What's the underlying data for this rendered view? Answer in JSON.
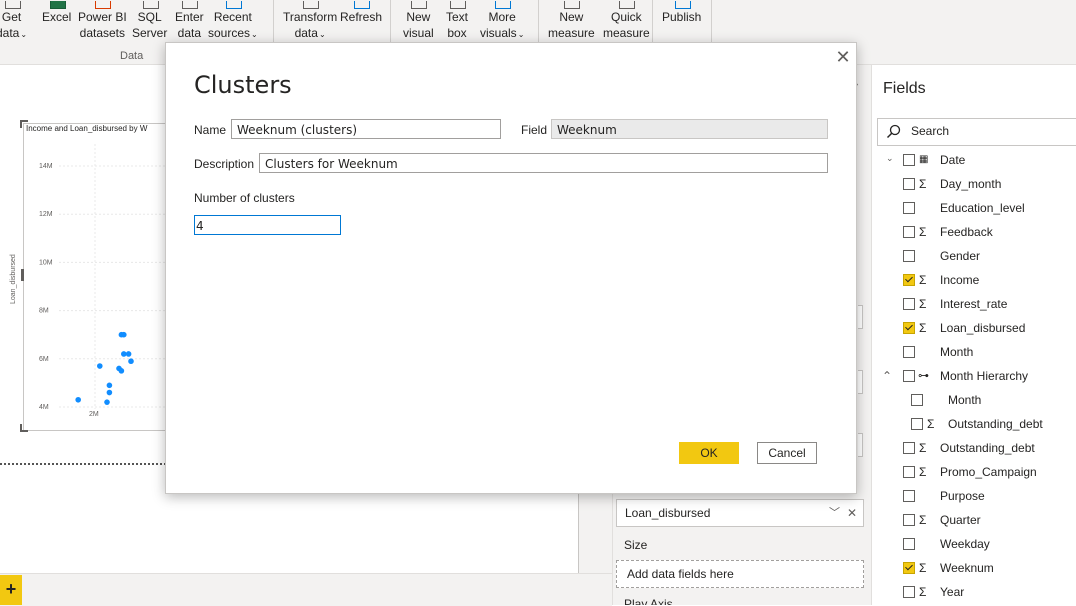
{
  "ribbon": {
    "buttons": [
      {
        "id": "get-data",
        "l1": "Get",
        "l2": "data",
        "chev": true
      },
      {
        "id": "excel",
        "l1": "Excel",
        "l2": "",
        "chev": false
      },
      {
        "id": "power-bi-datasets",
        "l1": "Power BI",
        "l2": "datasets",
        "chev": false
      },
      {
        "id": "sql-server",
        "l1": "SQL",
        "l2": "Server",
        "chev": false
      },
      {
        "id": "enter-data",
        "l1": "Enter",
        "l2": "data",
        "chev": false
      },
      {
        "id": "recent-sources",
        "l1": "Recent",
        "l2": "sources",
        "chev": true
      },
      {
        "id": "transform-data",
        "l1": "Transform",
        "l2": "data",
        "chev": true
      },
      {
        "id": "refresh",
        "l1": "Refresh",
        "l2": "",
        "chev": false
      },
      {
        "id": "new-visual",
        "l1": "New",
        "l2": "visual",
        "chev": false
      },
      {
        "id": "text-box",
        "l1": "Text",
        "l2": "box",
        "chev": false
      },
      {
        "id": "more-visuals",
        "l1": "More",
        "l2": "visuals",
        "chev": true
      },
      {
        "id": "new-measure",
        "l1": "New",
        "l2": "measure",
        "chev": false
      },
      {
        "id": "quick-measure",
        "l1": "Quick",
        "l2": "measure",
        "chev": false
      },
      {
        "id": "publish",
        "l1": "Publish",
        "l2": "",
        "chev": false
      }
    ],
    "group_data": "Data"
  },
  "visual": {
    "title": "Income and Loan_disbursed by W",
    "ylabel": "Loan_disbursed",
    "yticks": [
      "14M",
      "12M",
      "10M",
      "8M",
      "6M",
      "4M"
    ],
    "xticks": [
      "2M"
    ]
  },
  "chart_data": {
    "type": "scatter",
    "title": "Income and Loan_disbursed by W",
    "xlabel": "",
    "ylabel": "Loan_disbursed",
    "y_ticks": [
      "14M",
      "12M",
      "10M",
      "8M",
      "6M",
      "4M"
    ],
    "x_ticks": [
      "2M"
    ],
    "points": [
      {
        "x": 1.3,
        "y": 4.3
      },
      {
        "x": 2.5,
        "y": 4.2
      },
      {
        "x": 2.6,
        "y": 4.6
      },
      {
        "x": 2.6,
        "y": 4.9
      },
      {
        "x": 2.2,
        "y": 5.7
      },
      {
        "x": 3.0,
        "y": 5.6
      },
      {
        "x": 3.1,
        "y": 5.5
      },
      {
        "x": 3.2,
        "y": 6.2
      },
      {
        "x": 3.4,
        "y": 6.2
      },
      {
        "x": 3.5,
        "y": 5.9
      },
      {
        "x": 3.1,
        "y": 7.0
      },
      {
        "x": 3.2,
        "y": 7.0
      }
    ]
  },
  "dialog": {
    "title": "Clusters",
    "close_symbol": "✕",
    "name_label": "Name",
    "name_value": "Weeknum (clusters)",
    "field_label": "Field",
    "field_value": "Weeknum",
    "description_label": "Description",
    "description_value": "Clusters for Weeknum",
    "clusters_label": "Number of clusters",
    "clusters_value": "4",
    "ok_label": "OK",
    "cancel_label": "Cancel"
  },
  "vizpane": {
    "well_value": "Loan_disbursed",
    "size_label": "Size",
    "size_placeholder": "Add data fields here",
    "play_axis_label": "Play Axis"
  },
  "fields": {
    "title": "Fields",
    "search_placeholder": "Search",
    "items": [
      {
        "name": "Date",
        "sigma": false,
        "checked": false,
        "type": "calendar"
      },
      {
        "name": "Day_month",
        "sigma": true,
        "checked": false
      },
      {
        "name": "Education_level",
        "sigma": false,
        "checked": false
      },
      {
        "name": "Feedback",
        "sigma": true,
        "checked": false
      },
      {
        "name": "Gender",
        "sigma": false,
        "checked": false
      },
      {
        "name": "Income",
        "sigma": true,
        "checked": true
      },
      {
        "name": "Interest_rate",
        "sigma": true,
        "checked": false
      },
      {
        "name": "Loan_disbursed",
        "sigma": true,
        "checked": true
      },
      {
        "name": "Month",
        "sigma": false,
        "checked": false
      },
      {
        "name": "Month Hierarchy",
        "sigma": false,
        "checked": false,
        "type": "hierarchy",
        "expanded": true
      },
      {
        "name": "Month",
        "sigma": false,
        "checked": false,
        "indent": true
      },
      {
        "name": "Outstanding_debt",
        "sigma": true,
        "checked": false,
        "indent": true
      },
      {
        "name": "Outstanding_debt",
        "sigma": true,
        "checked": false
      },
      {
        "name": "Promo_Campaign",
        "sigma": true,
        "checked": false
      },
      {
        "name": "Purpose",
        "sigma": false,
        "checked": false
      },
      {
        "name": "Quarter",
        "sigma": true,
        "checked": false
      },
      {
        "name": "Weekday",
        "sigma": false,
        "checked": false
      },
      {
        "name": "Weeknum",
        "sigma": true,
        "checked": true
      },
      {
        "name": "Year",
        "sigma": true,
        "checked": false
      }
    ]
  },
  "bottom": {
    "add_page_symbol": "+"
  },
  "colors": {
    "accent": "#f2c811",
    "data_point": "#118dff",
    "focus": "#0078d4"
  }
}
